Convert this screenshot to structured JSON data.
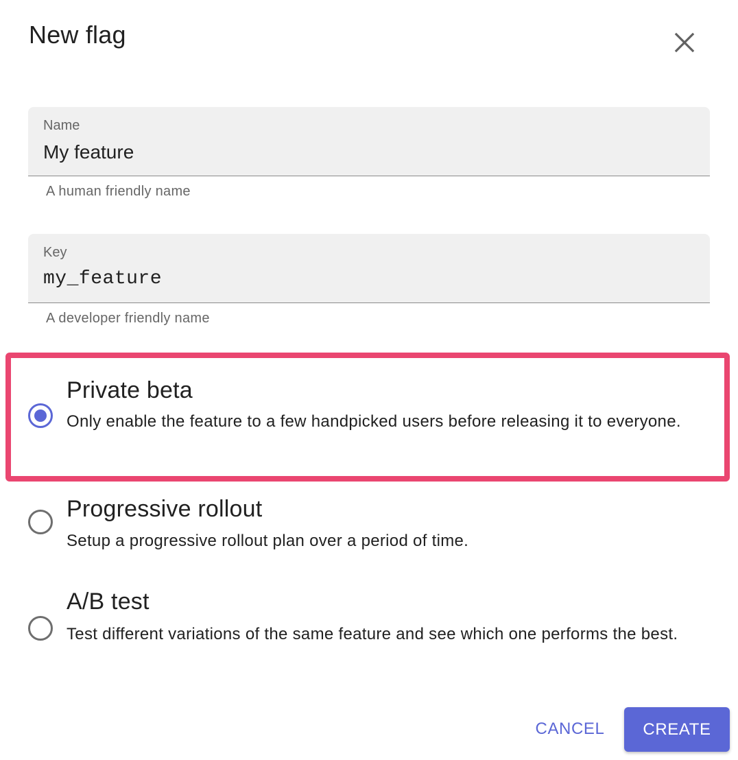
{
  "dialog": {
    "title": "New flag",
    "close_icon": "close-icon"
  },
  "fields": {
    "name": {
      "label": "Name",
      "value": "My feature",
      "helper": "A human friendly name"
    },
    "key": {
      "label": "Key",
      "value": "my_feature",
      "helper": "A developer friendly name"
    }
  },
  "options": [
    {
      "title": "Private beta",
      "description": "Only enable the feature to a few handpicked users before releasing it to everyone.",
      "selected": true
    },
    {
      "title": "Progressive rollout",
      "description": "Setup a progressive rollout plan over a period of time.",
      "selected": false
    },
    {
      "title": "A/B test",
      "description": "Test different variations of the same feature and see which one performs the best.",
      "selected": false
    }
  ],
  "actions": {
    "cancel_label": "CANCEL",
    "create_label": "CREATE"
  },
  "colors": {
    "accent": "#5b67d6",
    "highlight": "#ea4670",
    "field_bg": "#f0f0f0"
  }
}
